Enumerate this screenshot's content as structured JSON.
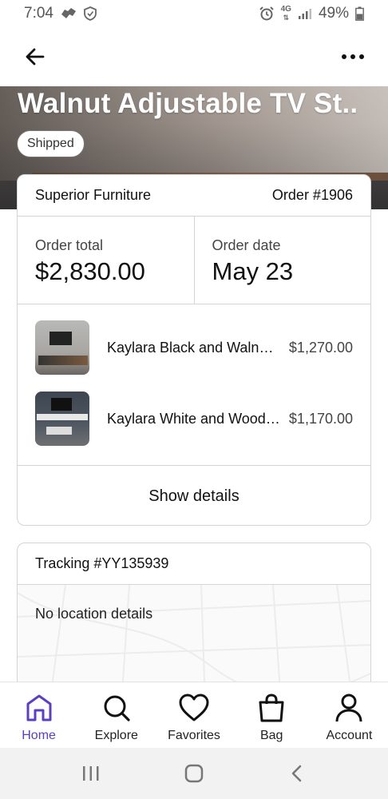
{
  "status_bar": {
    "time": "7:04",
    "battery": "49%",
    "network": "4G"
  },
  "app_bar": {
    "back_icon": "arrow-left-icon",
    "more_icon": "more-horizontal-icon"
  },
  "hero": {
    "title": "Walnut Adjustable TV St..",
    "status": "Shipped"
  },
  "order": {
    "seller": "Superior Furniture",
    "number": "Order #1906",
    "total_label": "Order total",
    "total_value": "$2,830.00",
    "date_label": "Order date",
    "date_value": "May 23",
    "items": [
      {
        "name": "Kaylara  Black and Walnut Adjustable TV Stand",
        "price": "$1,270.00"
      },
      {
        "name": "Kaylara  White and Wood Adjustable TV Stand",
        "price": "$1,170.00"
      }
    ],
    "show_details": "Show details"
  },
  "tracking": {
    "number": "Tracking #YY135939",
    "location": "No location details"
  },
  "bottom_nav": {
    "items": [
      {
        "label": "Home",
        "icon": "home-icon",
        "active": true
      },
      {
        "label": "Explore",
        "icon": "search-icon",
        "active": false
      },
      {
        "label": "Favorites",
        "icon": "heart-icon",
        "active": false
      },
      {
        "label": "Bag",
        "icon": "bag-icon",
        "active": false
      },
      {
        "label": "Account",
        "icon": "person-icon",
        "active": false
      }
    ]
  },
  "colors": {
    "accent": "#5b3fc0",
    "border": "#d4d4d4",
    "text": "#111111"
  }
}
